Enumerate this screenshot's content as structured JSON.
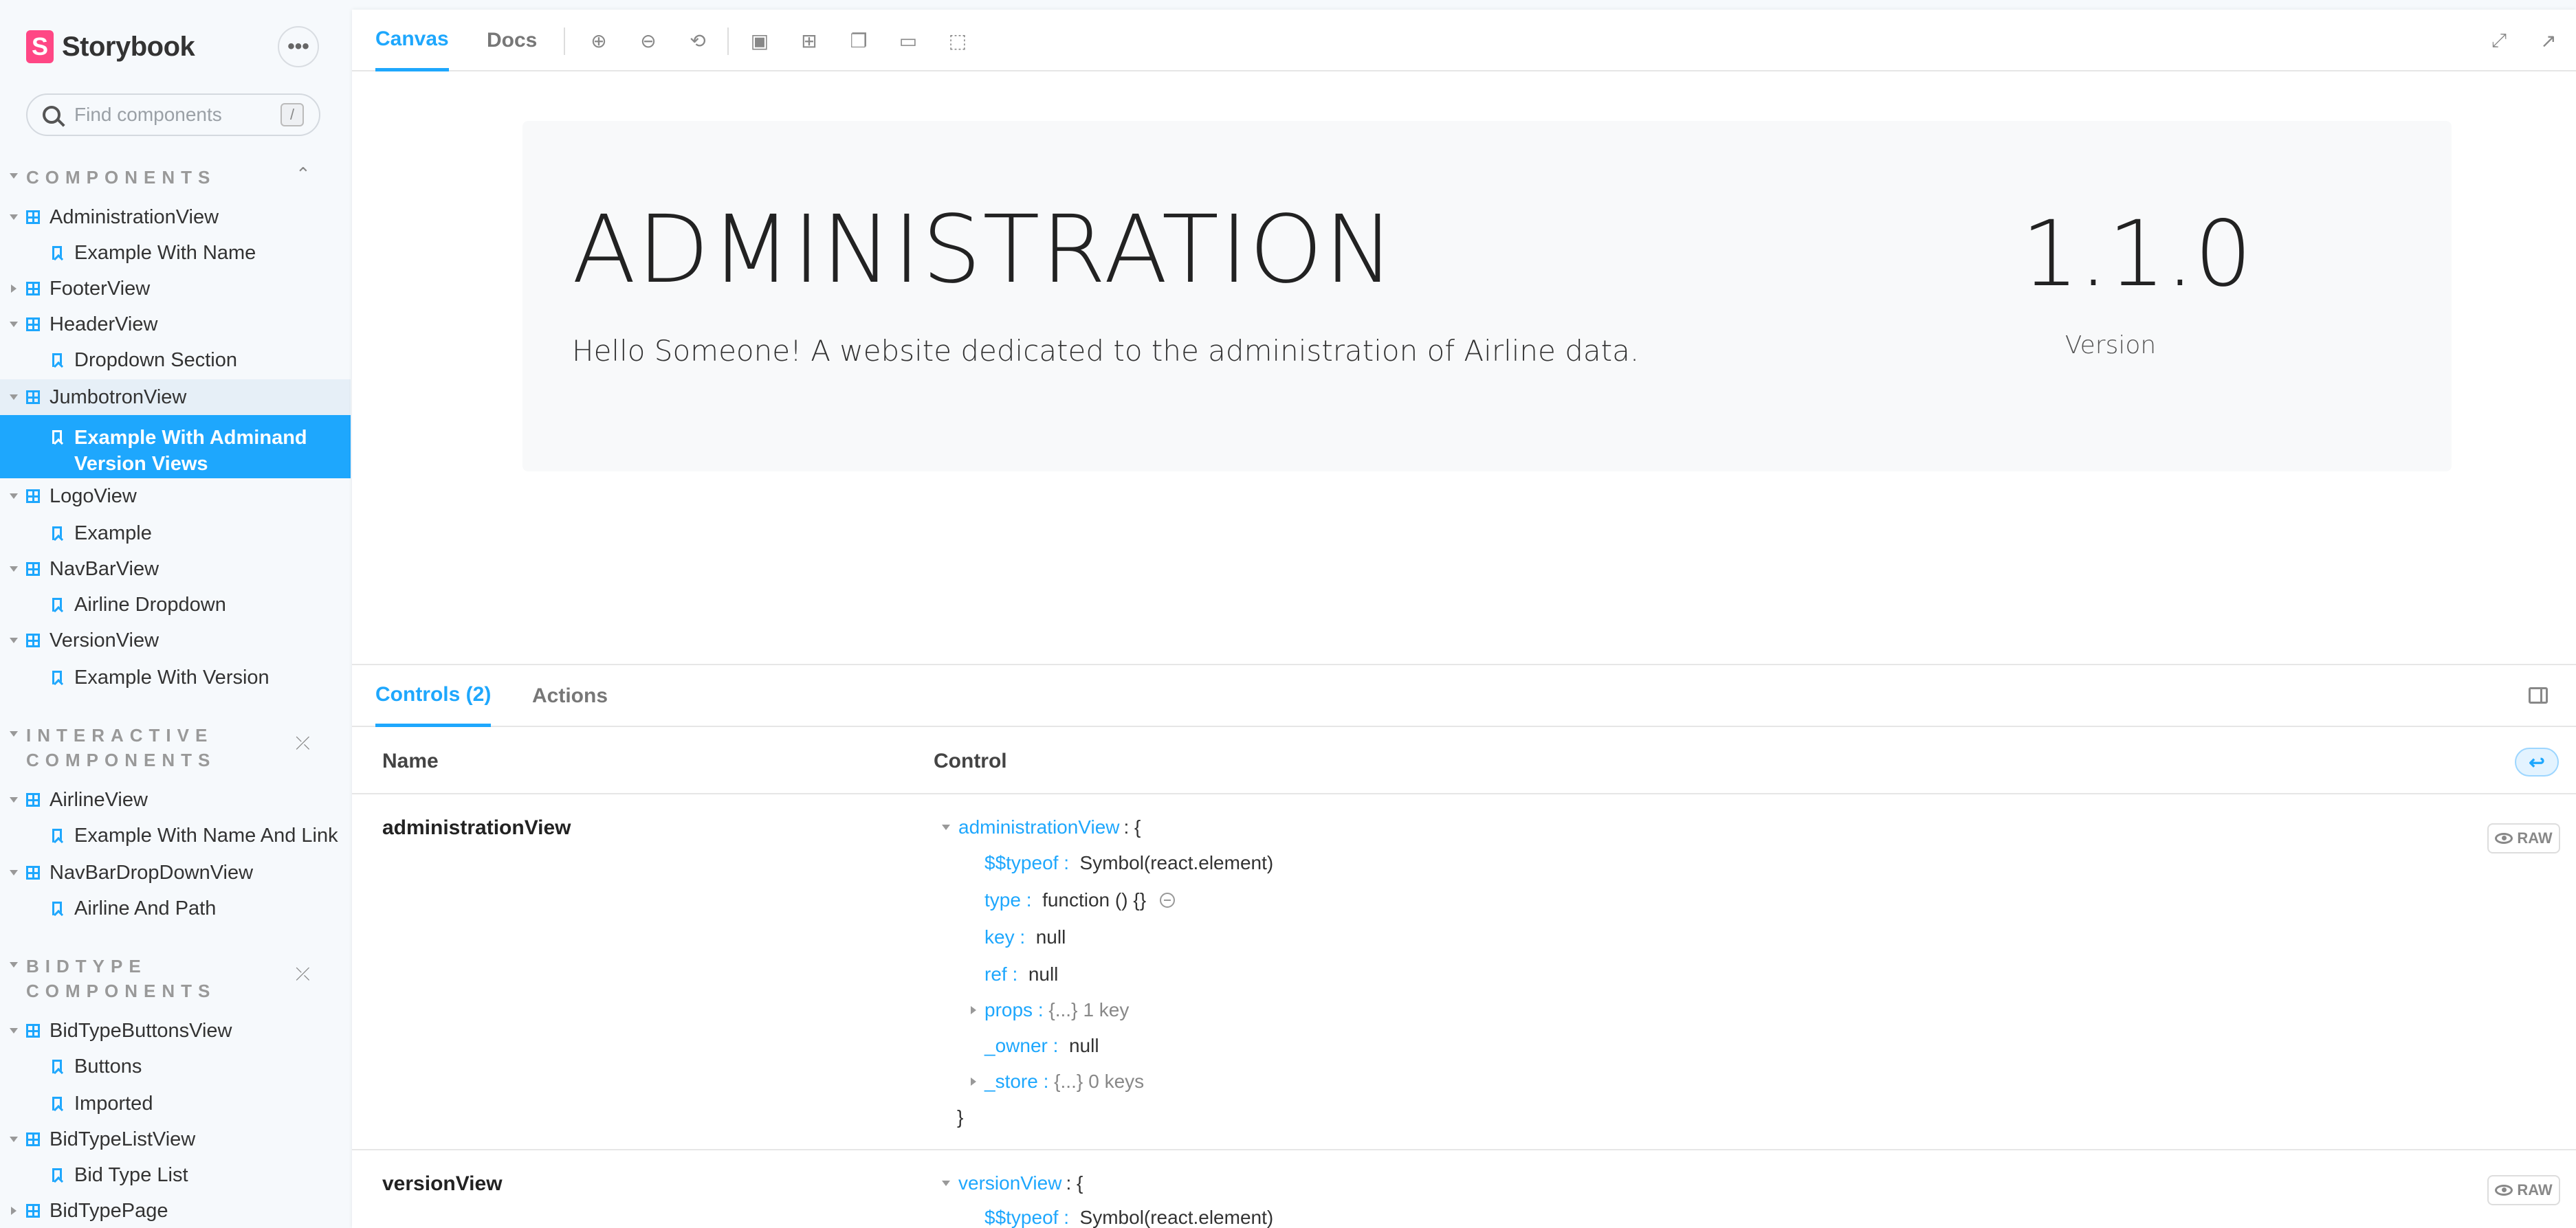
{
  "brand": {
    "name": "Storybook",
    "logo_letter": "S"
  },
  "search": {
    "placeholder": "Find components",
    "shortcut": "/"
  },
  "sidebar": {
    "sections": [
      {
        "title": "COMPONENTS"
      },
      {
        "title_line1": "INTERACTIVE",
        "title_line2": "COMPONENTS"
      },
      {
        "title_line1": "BIDTYPE",
        "title_line2": "COMPONENTS"
      }
    ],
    "items": [
      {
        "type": "component",
        "label": "AdministrationView"
      },
      {
        "type": "story",
        "label": "Example With Name"
      },
      {
        "type": "component",
        "label": "FooterView"
      },
      {
        "type": "component",
        "label": "HeaderView"
      },
      {
        "type": "story",
        "label": "Dropdown Section"
      },
      {
        "type": "component",
        "label": "JumbotronView"
      },
      {
        "type": "story",
        "label": "Example With Adminand Version Views"
      },
      {
        "type": "component",
        "label": "LogoView"
      },
      {
        "type": "story",
        "label": "Example"
      },
      {
        "type": "component",
        "label": "NavBarView"
      },
      {
        "type": "story",
        "label": "Airline Dropdown"
      },
      {
        "type": "component",
        "label": "VersionView"
      },
      {
        "type": "story",
        "label": "Example With Version"
      },
      {
        "type": "component",
        "label": "AirlineView"
      },
      {
        "type": "story",
        "label": "Example With Name And Link"
      },
      {
        "type": "component",
        "label": "NavBarDropDownView"
      },
      {
        "type": "story",
        "label": "Airline And Path"
      },
      {
        "type": "component",
        "label": "BidTypeButtonsView"
      },
      {
        "type": "story",
        "label": "Buttons"
      },
      {
        "type": "story",
        "label": "Imported"
      },
      {
        "type": "component",
        "label": "BidTypeListView"
      },
      {
        "type": "story",
        "label": "Bid Type List"
      },
      {
        "type": "component",
        "label": "BidTypePage"
      }
    ]
  },
  "toolbar": {
    "tabs": [
      {
        "label": "Canvas"
      },
      {
        "label": "Docs"
      }
    ]
  },
  "preview": {
    "title": "ADMINISTRATION",
    "subtitle": "Hello Someone! A website dedicated to the administration of Airline data.",
    "version": "1.1.0",
    "version_label": "Version"
  },
  "panel": {
    "tabs": [
      {
        "label": "Controls (2)"
      },
      {
        "label": "Actions"
      }
    ],
    "columns": {
      "name": "Name",
      "control": "Control"
    },
    "raw_label": "RAW",
    "rows": [
      {
        "name": "administrationView",
        "root_key": "administrationView",
        "root_open": ": {",
        "fields": [
          {
            "key": "$$typeof",
            "value": "Symbol(react.element)"
          },
          {
            "key": "type",
            "value": "function () {}"
          },
          {
            "key": "key",
            "value": "null"
          },
          {
            "key": "ref",
            "value": "null"
          },
          {
            "key": "props",
            "value": "{...}",
            "meta": "1 key"
          },
          {
            "key": "_owner",
            "value": "null"
          },
          {
            "key": "_store",
            "value": "{...}",
            "meta": "0 keys"
          }
        ],
        "close": "}"
      },
      {
        "name": "versionView",
        "root_key": "versionView",
        "root_open": ": {",
        "fields": [
          {
            "key": "$$typeof",
            "value": "Symbol(react.element)"
          }
        ]
      }
    ]
  },
  "colors": {
    "accent": "#1ea7fd",
    "brand": "#ff4785"
  }
}
